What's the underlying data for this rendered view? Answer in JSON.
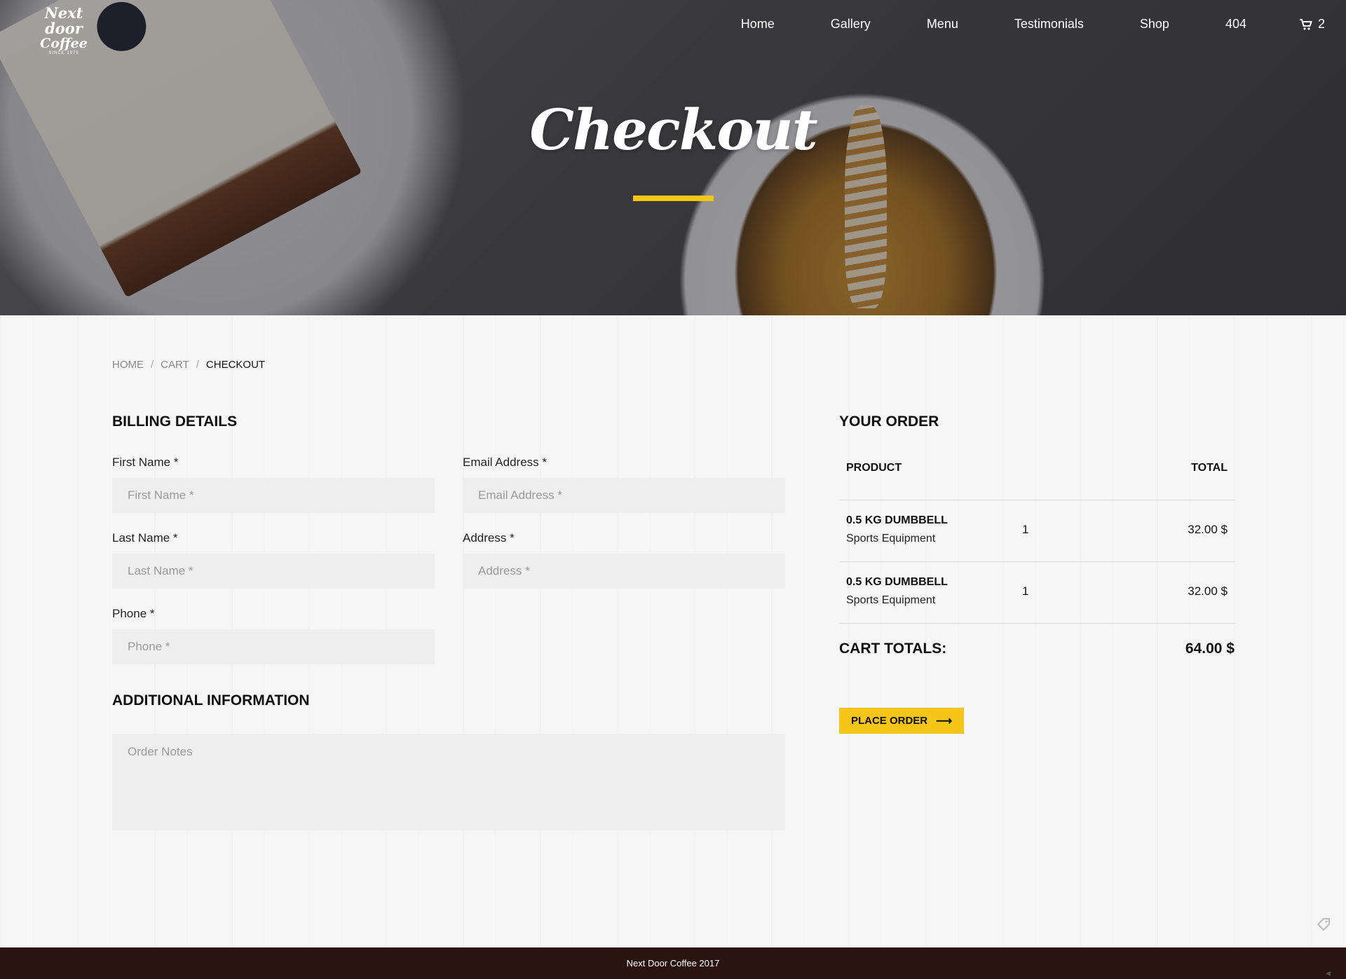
{
  "brand": {
    "logo_line1": "Next door",
    "logo_line2": "Coffee",
    "logo_line3": "SINCE 1975"
  },
  "nav": {
    "items": [
      "Home",
      "Gallery",
      "Menu",
      "Testimonials",
      "Shop",
      "404"
    ],
    "cart_icon": "cart-icon",
    "cart_count": "2"
  },
  "hero": {
    "title": "Checkout"
  },
  "breadcrumb": {
    "items": [
      "HOME",
      "CART",
      "CHECKOUT"
    ],
    "separator": "/"
  },
  "billing": {
    "title": "BILLING DETAILS",
    "first_name": {
      "label": "First Name *",
      "placeholder": "First Name *",
      "value": ""
    },
    "last_name": {
      "label": "Last Name *",
      "placeholder": "Last Name *",
      "value": ""
    },
    "phone": {
      "label": "Phone *",
      "placeholder": "Phone *",
      "value": ""
    },
    "email": {
      "label": "Email Address *",
      "placeholder": "Email Address *",
      "value": ""
    },
    "address": {
      "label": "Address *",
      "placeholder": "Address *",
      "value": ""
    }
  },
  "additional": {
    "title": "ADDITIONAL INFORMATION",
    "notes_placeholder": "Order Notes"
  },
  "order": {
    "title": "YOUR ORDER",
    "col_product": "PRODUCT",
    "col_total": "TOTAL",
    "rows": [
      {
        "name": "0.5 KG DUMBBELL",
        "category": "Sports Equipment",
        "qty": "1",
        "price": "32.00 $"
      },
      {
        "name": "0.5 KG DUMBBELL",
        "category": "Sports Equipment",
        "qty": "1",
        "price": "32.00 $"
      }
    ],
    "totals_label": "CART TOTALS:",
    "totals_value": "64.00 $",
    "place_order_label": "PLACE ORDER",
    "place_order_arrow": "⟶"
  },
  "footer": {
    "text": "Next Door Coffee 2017"
  },
  "colors": {
    "accent": "#f5c518",
    "footer_bg": "#2a1410",
    "field_bg": "#eeeeee"
  }
}
